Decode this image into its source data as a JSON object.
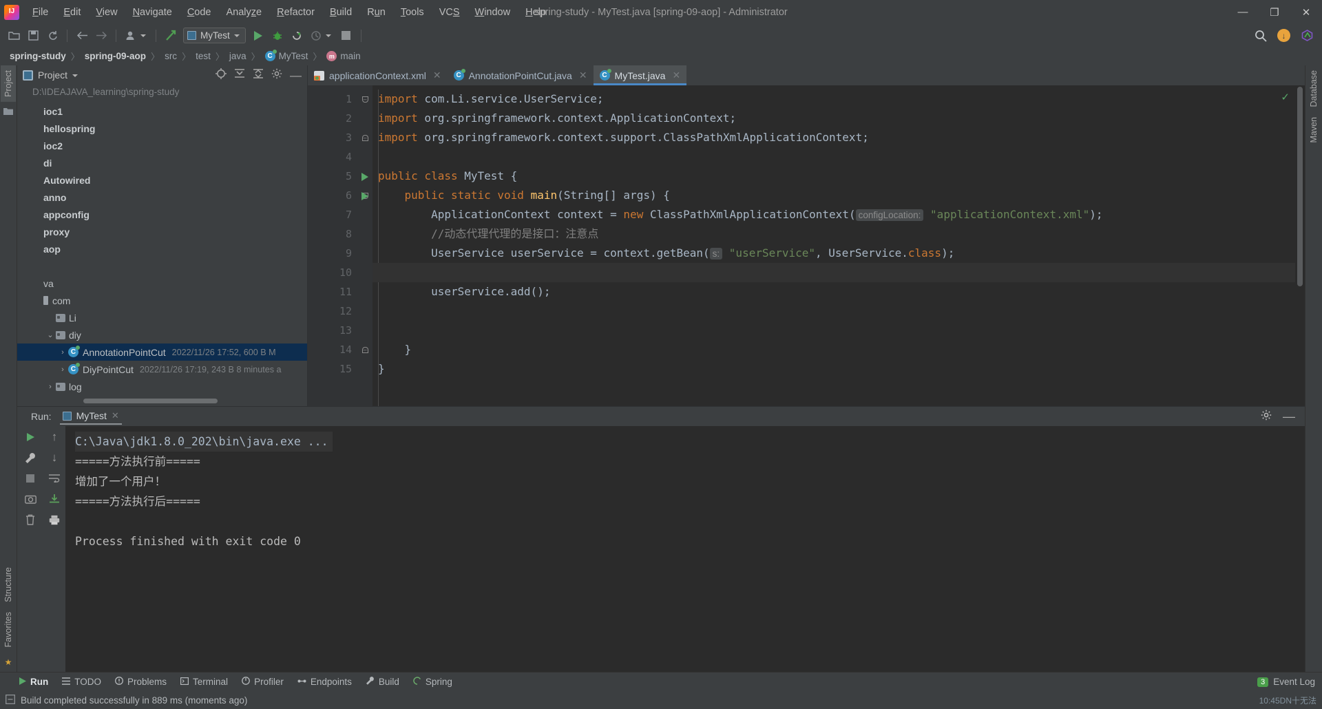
{
  "window": {
    "title": "spring-study - MyTest.java [spring-09-aop] - Administrator",
    "minimize": "—",
    "maximize": "❐",
    "close": "✕",
    "logo_text": "IJ"
  },
  "menubar": {
    "items": [
      {
        "label": "File",
        "mnemonic": "F"
      },
      {
        "label": "Edit",
        "mnemonic": "E"
      },
      {
        "label": "View",
        "mnemonic": "V"
      },
      {
        "label": "Navigate",
        "mnemonic": "N"
      },
      {
        "label": "Code",
        "mnemonic": "C"
      },
      {
        "label": "Analyze",
        "mnemonic": "z"
      },
      {
        "label": "Refactor",
        "mnemonic": "R"
      },
      {
        "label": "Build",
        "mnemonic": "B"
      },
      {
        "label": "Run",
        "mnemonic": "u"
      },
      {
        "label": "Tools",
        "mnemonic": "T"
      },
      {
        "label": "VCS",
        "mnemonic": "S"
      },
      {
        "label": "Window",
        "mnemonic": "W"
      },
      {
        "label": "Help",
        "mnemonic": "H"
      }
    ]
  },
  "toolbar": {
    "run_config": "MyTest",
    "icons": [
      "open-folder-icon",
      "save-all-icon",
      "sync-icon",
      "back-arrow-icon",
      "forward-arrow-icon",
      "profile-icon",
      "update-project-icon"
    ],
    "right_icons": [
      "search-icon",
      "update-badge-icon",
      "ide-launch-icon"
    ],
    "update_badge": "↓"
  },
  "breadcrumb": {
    "items": [
      {
        "label": "spring-study",
        "bold": true,
        "icon": ""
      },
      {
        "label": "spring-09-aop",
        "bold": true,
        "icon": ""
      },
      {
        "label": "src",
        "bold": false,
        "icon": ""
      },
      {
        "label": "test",
        "bold": false,
        "icon": ""
      },
      {
        "label": "java",
        "bold": false,
        "icon": ""
      },
      {
        "label": "MyTest",
        "bold": false,
        "icon": "class-icon"
      },
      {
        "label": "main",
        "bold": false,
        "icon": "method-icon"
      }
    ],
    "separator": "〉"
  },
  "left_rail": {
    "project_tab": "Project",
    "structure_tab": "Structure",
    "favorites_tab": "Favorites"
  },
  "right_rail": {
    "database_tab": "Database",
    "maven_tab": "Maven"
  },
  "project_panel": {
    "title": "Project",
    "path": "D:\\IDEAJAVA_learning\\spring-study",
    "action_icons": [
      "locate-icon",
      "expand-all-icon",
      "collapse-all-icon",
      "gear-icon",
      "hide-icon"
    ],
    "tree": [
      {
        "label": "ioc1",
        "indent": 0,
        "bold": true,
        "twisty": "",
        "icon": "",
        "meta": "",
        "selected": false
      },
      {
        "label": "hellospring",
        "indent": 0,
        "bold": true,
        "twisty": "",
        "icon": "",
        "meta": "",
        "selected": false
      },
      {
        "label": "ioc2",
        "indent": 0,
        "bold": true,
        "twisty": "",
        "icon": "",
        "meta": "",
        "selected": false
      },
      {
        "label": "di",
        "indent": 0,
        "bold": true,
        "twisty": "",
        "icon": "",
        "meta": "",
        "selected": false
      },
      {
        "label": "Autowired",
        "indent": 0,
        "bold": true,
        "twisty": "",
        "icon": "",
        "meta": "",
        "selected": false
      },
      {
        "label": "anno",
        "indent": 0,
        "bold": true,
        "twisty": "",
        "icon": "",
        "meta": "",
        "selected": false
      },
      {
        "label": "appconfig",
        "indent": 0,
        "bold": true,
        "twisty": "",
        "icon": "",
        "meta": "",
        "selected": false
      },
      {
        "label": "proxy",
        "indent": 0,
        "bold": true,
        "twisty": "",
        "icon": "",
        "meta": "",
        "selected": false
      },
      {
        "label": "aop",
        "indent": 0,
        "bold": true,
        "twisty": "",
        "icon": "",
        "meta": "",
        "selected": false
      },
      {
        "label": "",
        "indent": 0,
        "bold": false,
        "twisty": "",
        "icon": "",
        "meta": "",
        "selected": false
      },
      {
        "label": "va",
        "indent": 0,
        "bold": false,
        "twisty": "",
        "icon": "",
        "meta": "",
        "selected": false
      },
      {
        "label": "com",
        "indent": 0,
        "bold": false,
        "twisty": "",
        "icon": "module-icon",
        "meta": "",
        "selected": false
      },
      {
        "label": "Li",
        "indent": 1,
        "bold": false,
        "twisty": "",
        "icon": "folder-icon",
        "meta": "",
        "selected": false
      },
      {
        "label": "diy",
        "indent": 1,
        "bold": false,
        "twisty": "⌄",
        "icon": "folder-icon",
        "meta": "",
        "selected": false
      },
      {
        "label": "AnnotationPointCut",
        "indent": 2,
        "bold": false,
        "twisty": "›",
        "icon": "class-icon",
        "meta": "2022/11/26 17:52, 600 B M",
        "selected": true
      },
      {
        "label": "DiyPointCut",
        "indent": 2,
        "bold": false,
        "twisty": "›",
        "icon": "class-icon",
        "meta": "2022/11/26 17:19, 243 B 8 minutes a",
        "selected": false
      },
      {
        "label": "log",
        "indent": 1,
        "bold": false,
        "twisty": "›",
        "icon": "folder-icon",
        "meta": "",
        "selected": false
      }
    ]
  },
  "editor": {
    "tabs": [
      {
        "label": "applicationContext.xml",
        "icon": "xml-file-icon",
        "active": false,
        "close": "✕"
      },
      {
        "label": "AnnotationPointCut.java",
        "icon": "class-icon",
        "active": false,
        "close": "✕"
      },
      {
        "label": "MyTest.java",
        "icon": "class-icon",
        "active": true,
        "close": "✕"
      }
    ],
    "inspection_ok": "✓",
    "lines": [
      {
        "n": "1",
        "run": false,
        "fold": "minus",
        "html": "<span class='kw'>import</span> com.Li.service.UserService;"
      },
      {
        "n": "2",
        "run": false,
        "fold": "",
        "html": "<span class='kw'>import</span> org.springframework.context.ApplicationContext;"
      },
      {
        "n": "3",
        "run": false,
        "fold": "end",
        "html": "<span class='kw'>import</span> org.springframework.context.support.ClassPathXmlApplicationContext;"
      },
      {
        "n": "4",
        "run": false,
        "fold": "",
        "html": ""
      },
      {
        "n": "5",
        "run": true,
        "fold": "",
        "html": "<span class='kw'>public class</span> <span style='color:#a9b7c6'>MyTest</span> {"
      },
      {
        "n": "6",
        "run": true,
        "fold": "minus",
        "html": "    <span class='kw'>public static void</span> <span class='fn'>main</span>(String[] args) {"
      },
      {
        "n": "7",
        "run": false,
        "fold": "",
        "html": "        ApplicationContext context = <span class='kw'>new</span> ClassPathXmlApplicationContext(<span class='hint'>configLocation:</span> <span class='str'>\"applicationContext.xml\"</span>);"
      },
      {
        "n": "8",
        "run": false,
        "fold": "",
        "html": "        <span class='cmt'>//动态代理代理的是接口：注意点</span>"
      },
      {
        "n": "9",
        "run": false,
        "fold": "",
        "html": "        UserService userService = context.getBean(<span class='hint'>s:</span> <span class='str'>\"userService\"</span>, UserService.<span class='kw'>class</span>);"
      },
      {
        "n": "10",
        "run": false,
        "fold": "",
        "html": "",
        "caret": true
      },
      {
        "n": "11",
        "run": false,
        "fold": "",
        "html": "        userService.add();"
      },
      {
        "n": "12",
        "run": false,
        "fold": "",
        "html": ""
      },
      {
        "n": "13",
        "run": false,
        "fold": "",
        "html": ""
      },
      {
        "n": "14",
        "run": false,
        "fold": "end",
        "html": "    }"
      },
      {
        "n": "15",
        "run": false,
        "fold": "",
        "html": "}"
      }
    ]
  },
  "console": {
    "run_label": "Run:",
    "tab_label": "MyTest",
    "tab_close": "✕",
    "header_icons": [
      "gear-icon",
      "hide-icon"
    ],
    "rail_icons": [
      "rerun-icon",
      "scroll-up-icon",
      "stop-icon",
      "wrap-text-icon",
      "camera-icon",
      "export-icon",
      "print-icon",
      "trash-icon"
    ],
    "output": [
      {
        "text": "C:\\Java\\jdk1.8.0_202\\bin\\java.exe ...",
        "highlight": true
      },
      {
        "text": "=====方法执行前=====",
        "highlight": false
      },
      {
        "text": "增加了一个用户！",
        "highlight": false
      },
      {
        "text": "=====方法执行后=====",
        "highlight": false
      },
      {
        "text": "",
        "highlight": false
      },
      {
        "text": "Process finished with exit code 0",
        "highlight": false
      }
    ]
  },
  "toolwindow_bar": {
    "items": [
      {
        "label": "Run",
        "icon": "play-icon",
        "active": true
      },
      {
        "label": "TODO",
        "icon": "todo-icon",
        "active": false
      },
      {
        "label": "Problems",
        "icon": "problems-icon",
        "active": false
      },
      {
        "label": "Terminal",
        "icon": "terminal-icon",
        "active": false
      },
      {
        "label": "Profiler",
        "icon": "profiler-icon",
        "active": false
      },
      {
        "label": "Endpoints",
        "icon": "endpoints-icon",
        "active": false
      },
      {
        "label": "Build",
        "icon": "build-icon",
        "active": false
      },
      {
        "label": "Spring",
        "icon": "spring-icon",
        "active": false
      }
    ],
    "event_log": "Event Log",
    "event_count": "3"
  },
  "statusbar": {
    "message": "Build completed successfully in 889 ms (moments ago)",
    "right_text": "10:45DN十无法",
    "icon": "status-icon"
  }
}
